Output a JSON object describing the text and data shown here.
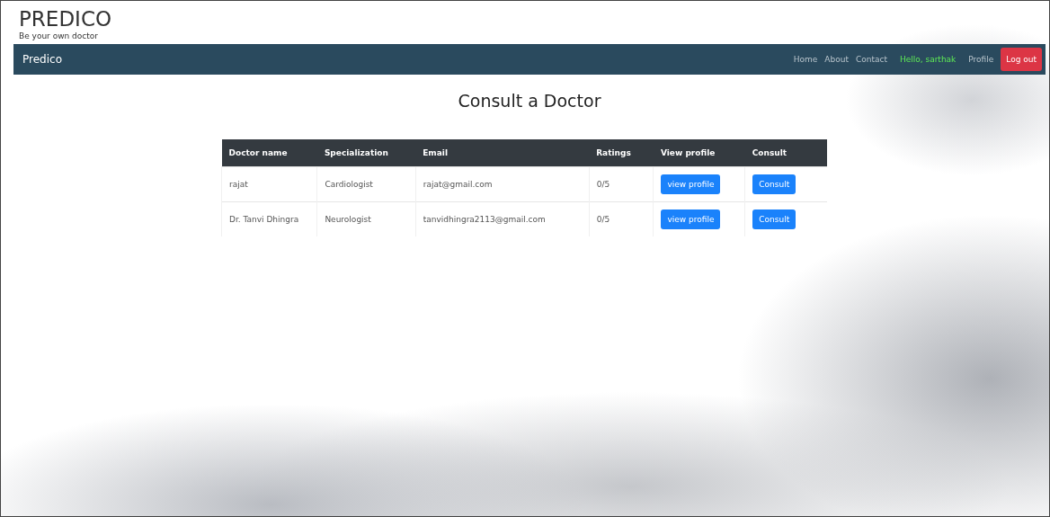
{
  "site": {
    "title": "PREDICO",
    "tagline": "Be your own doctor"
  },
  "navbar": {
    "brand": "Predico",
    "links": [
      {
        "kind": "link",
        "label": "Home"
      },
      {
        "kind": "link",
        "label": "About"
      },
      {
        "kind": "link",
        "label": "Contact"
      },
      {
        "kind": "greeting",
        "label": "Hello, sarthak"
      },
      {
        "kind": "link",
        "label": "Profile"
      },
      {
        "kind": "button",
        "label": "Log out"
      }
    ]
  },
  "heading": "Consult a Doctor",
  "table": {
    "columns": [
      "Doctor name",
      "Specialization",
      "Email",
      "Ratings",
      "View profile",
      "Consult"
    ],
    "rows": [
      {
        "name": "rajat",
        "specialization": "Cardiologist",
        "email": "rajat@gmail.com",
        "rating": "0/5",
        "profile_button": "view profile",
        "consult_button": "Consult"
      },
      {
        "name": "Dr. Tanvi Dhingra",
        "specialization": "Neurologist",
        "email": "tanvidhingra2113@gmail.com",
        "rating": "0/5",
        "profile_button": "view profile",
        "consult_button": "Consult"
      }
    ]
  }
}
